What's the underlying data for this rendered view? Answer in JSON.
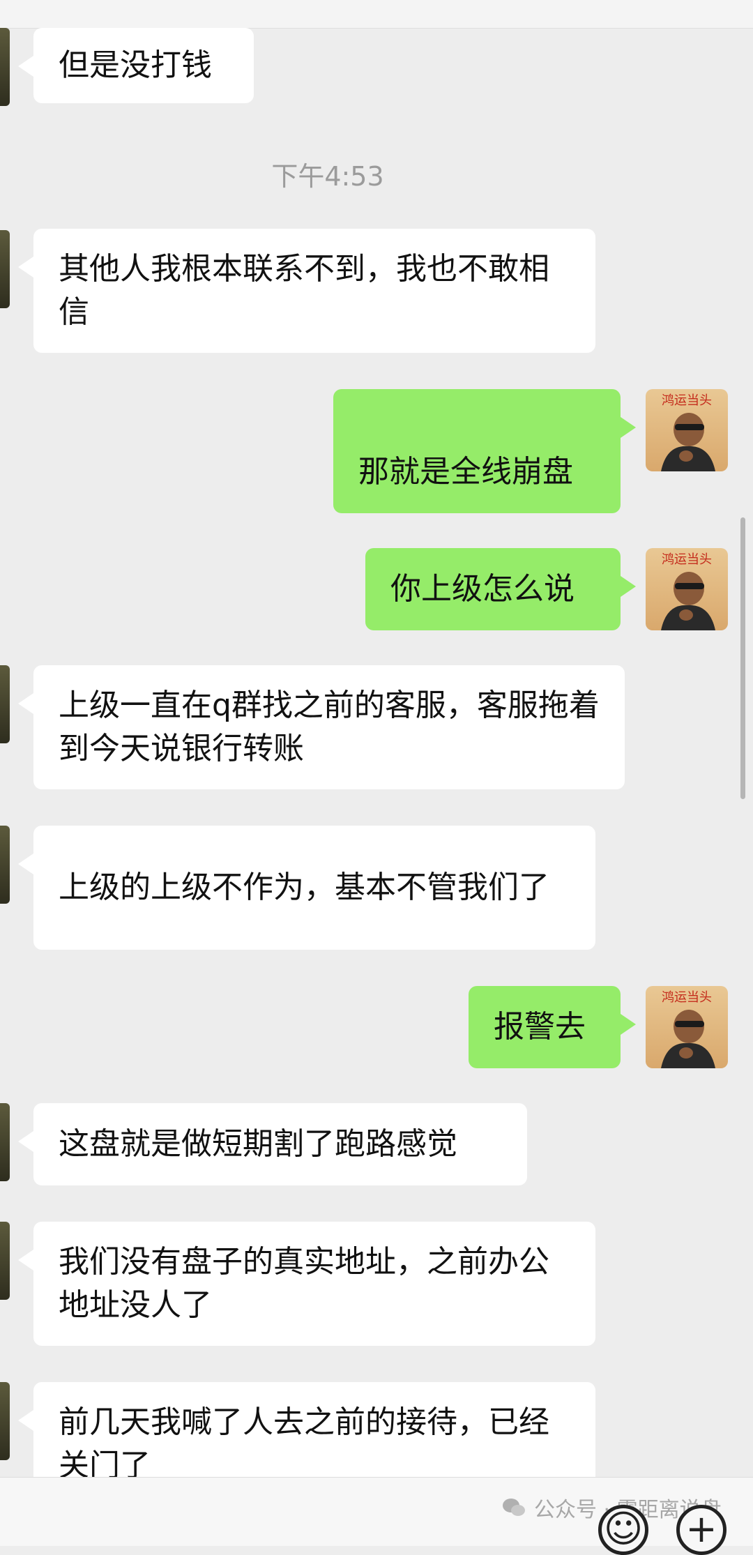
{
  "chat": {
    "timestamp": "下午4:53",
    "messages": [
      {
        "side": "in",
        "text": "但是没打钱"
      },
      {
        "side": "in",
        "text": "其他人我根本联系不到，我也不敢相信"
      },
      {
        "side": "out",
        "text": "那就是全线崩盘"
      },
      {
        "side": "out",
        "text": "你上级怎么说"
      },
      {
        "side": "in",
        "text": "上级一直在q群找之前的客服，客服拖着到今天说银行转账"
      },
      {
        "side": "in",
        "text": "上级的上级不作为，基本不管我们了"
      },
      {
        "side": "out",
        "text": "报警去"
      },
      {
        "side": "in",
        "text": "这盘就是做短期割了跑路感觉"
      },
      {
        "side": "in",
        "text": "我们没有盘子的真实地址，之前办公地址没人了"
      },
      {
        "side": "in",
        "text": "前几天我喊了人去之前的接待，已经关门了"
      }
    ],
    "avatar_text": "鸿运当头"
  },
  "watermark": {
    "icon": "wechat-icon",
    "text": "公众号 · 零距离说盘"
  },
  "input_bar": {
    "emoji_icon": "☺",
    "plus_icon": "+"
  }
}
